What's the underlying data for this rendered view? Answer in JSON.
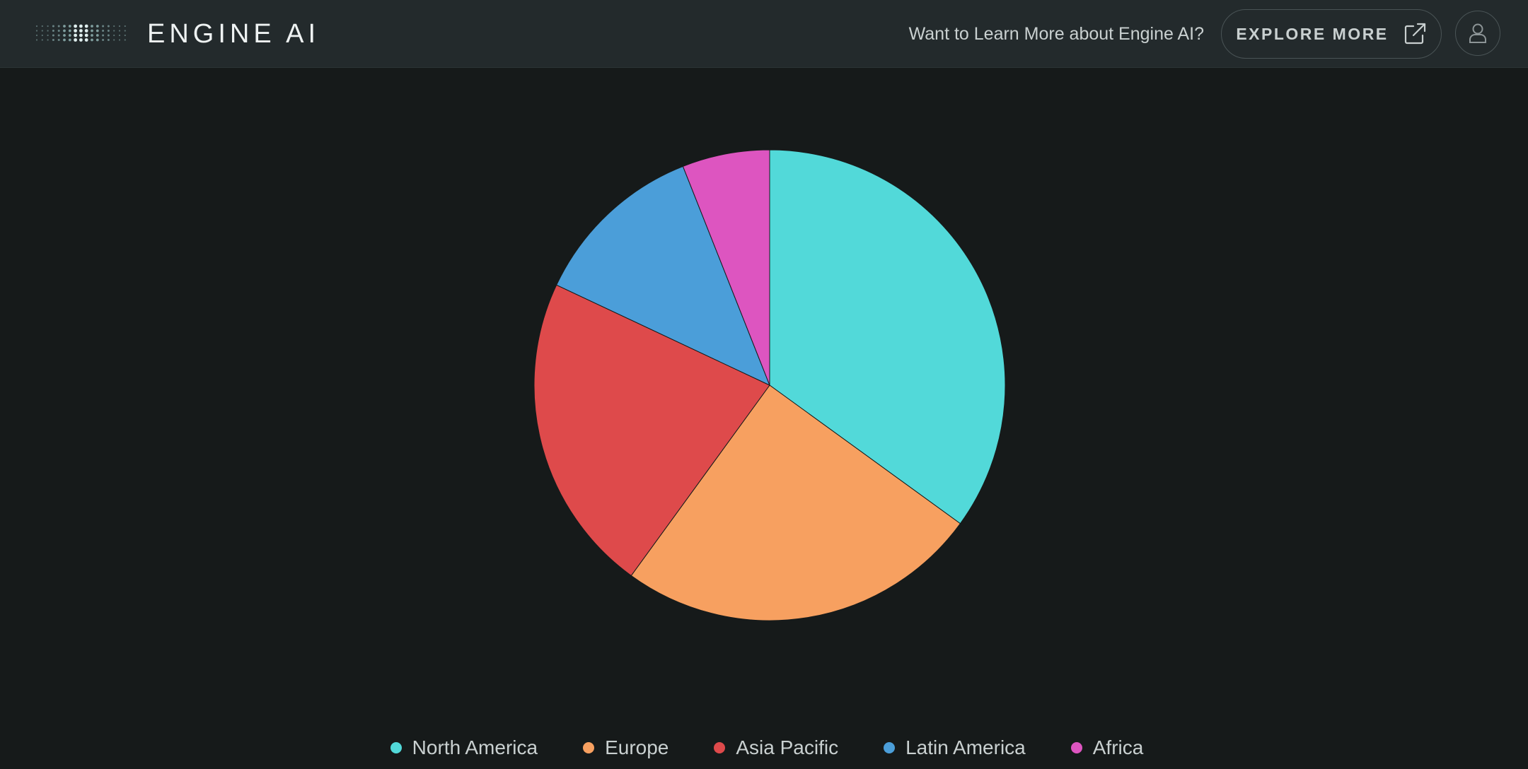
{
  "header": {
    "logo_text": "ENGINE AI",
    "promo_text": "Want to Learn More about Engine AI?",
    "explore_label": "EXPLORE MORE",
    "explore_icon": "external-link-icon",
    "user_icon": "user-icon"
  },
  "chart_data": {
    "type": "pie",
    "categories": [
      "North America",
      "Europe",
      "Asia Pacific",
      "Latin America",
      "Africa"
    ],
    "values": [
      35,
      25,
      22,
      12,
      6
    ],
    "colors": [
      "#52d9d9",
      "#f7a060",
      "#de4a4b",
      "#4b9ed9",
      "#dd55c0"
    ],
    "start_angle": "12 o'clock",
    "direction": "clockwise",
    "legend_position": "bottom"
  }
}
